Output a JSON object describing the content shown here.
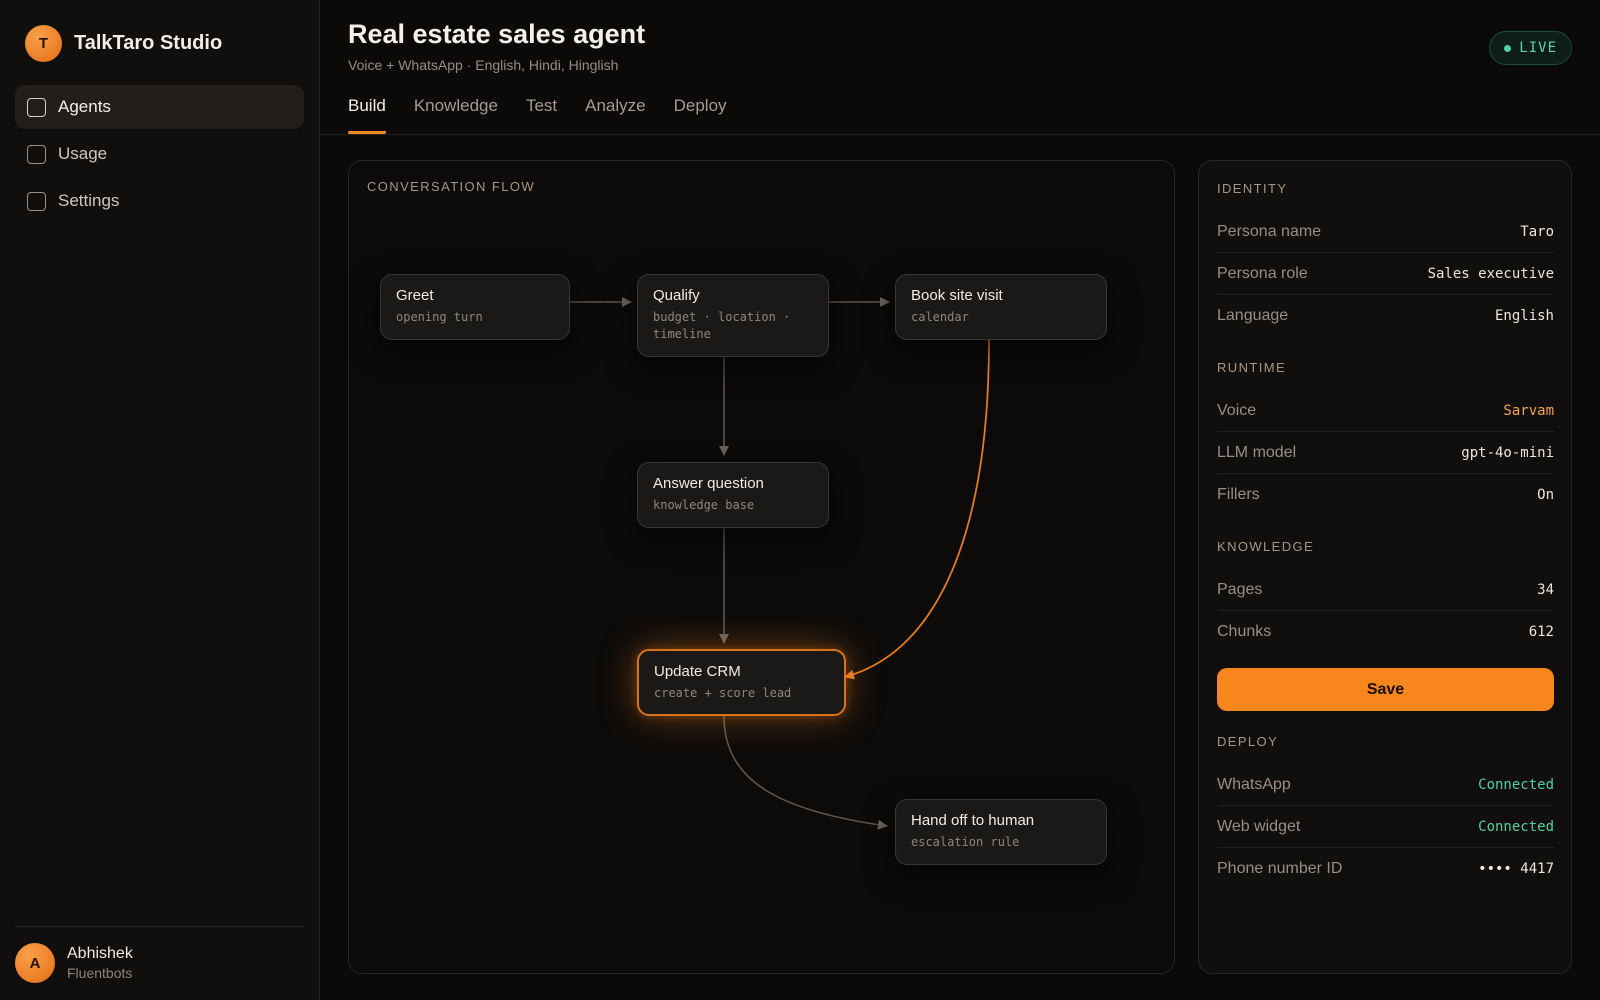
{
  "app": {
    "name": "TalkTaro Studio",
    "logo_initial": "T"
  },
  "sidebar": {
    "items": [
      {
        "label": "Agents",
        "active": true
      },
      {
        "label": "Usage",
        "active": false
      },
      {
        "label": "Settings",
        "active": false
      }
    ]
  },
  "user": {
    "initial": "A",
    "name": "Abhishek",
    "org": "Fluentbots"
  },
  "header": {
    "title": "Real estate sales agent",
    "subtitle": "Voice + WhatsApp · English, Hindi, Hinglish",
    "status": "LIVE",
    "tabs": [
      {
        "label": "Build",
        "active": true
      },
      {
        "label": "Knowledge",
        "active": false
      },
      {
        "label": "Test",
        "active": false
      },
      {
        "label": "Analyze",
        "active": false
      },
      {
        "label": "Deploy",
        "active": false
      }
    ]
  },
  "flow": {
    "label": "CONVERSATION FLOW",
    "nodes": [
      {
        "title": "Greet",
        "sub": "opening turn"
      },
      {
        "title": "Qualify",
        "sub": "budget · location · timeline"
      },
      {
        "title": "Book site visit",
        "sub": "calendar"
      },
      {
        "title": "Answer question",
        "sub": "knowledge base"
      },
      {
        "title": "Update CRM",
        "sub": "create + score lead"
      },
      {
        "title": "Hand off to human",
        "sub": "escalation rule"
      }
    ]
  },
  "panel": {
    "identity": {
      "label": "IDENTITY",
      "rows": [
        {
          "key": "Persona name",
          "value": "Taro"
        },
        {
          "key": "Persona role",
          "value": "Sales executive"
        },
        {
          "key": "Language",
          "value": "English"
        }
      ]
    },
    "runtime": {
      "label": "RUNTIME",
      "rows": [
        {
          "key": "Voice",
          "value": "Sarvam"
        },
        {
          "key": "LLM model",
          "value": "gpt-4o-mini"
        },
        {
          "key": "Fillers",
          "value": "On"
        }
      ]
    },
    "knowledge": {
      "label": "KNOWLEDGE",
      "rows": [
        {
          "key": "Pages",
          "value": "34"
        },
        {
          "key": "Chunks",
          "value": "612"
        }
      ]
    },
    "save_label": "Save",
    "deploy": {
      "label": "DEPLOY",
      "rows": [
        {
          "key": "WhatsApp",
          "value": "Connected"
        },
        {
          "key": "Web widget",
          "value": "Connected"
        },
        {
          "key": "Phone number ID",
          "value": "•••• 4417"
        }
      ]
    }
  },
  "colors": {
    "accent": "#f7861c",
    "success": "#52cfa0",
    "background": "#0b0a09"
  }
}
